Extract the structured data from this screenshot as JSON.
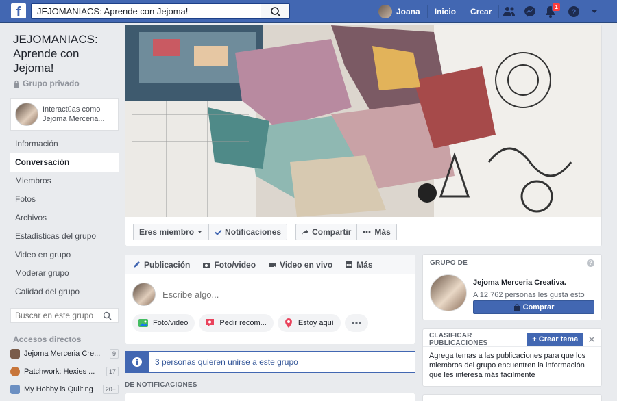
{
  "topbar": {
    "logo": "f",
    "search_value": "JEJOMANIACS: Aprende con Jejoma!",
    "user_name": "Joana",
    "home_label": "Inicio",
    "create_label": "Crear",
    "notification_count": "1"
  },
  "group": {
    "title": "JEJOMANIACS: Aprende con Jejoma!",
    "privacy": "Grupo privado",
    "interacting_as": "Interactúas como Jejoma Merceria..."
  },
  "nav": {
    "items": [
      {
        "label": "Información"
      },
      {
        "label": "Conversación"
      },
      {
        "label": "Miembros"
      },
      {
        "label": "Fotos"
      },
      {
        "label": "Archivos"
      },
      {
        "label": "Estadísticas del grupo"
      },
      {
        "label": "Video en grupo"
      },
      {
        "label": "Moderar grupo"
      },
      {
        "label": "Calidad del grupo"
      }
    ],
    "search_placeholder": "Buscar en este grupo"
  },
  "shortcuts": {
    "heading": "Accesos directos",
    "items": [
      {
        "label": "Jejoma Merceria Cre...",
        "count": "9",
        "color": "#7a5c4a"
      },
      {
        "label": "Patchwork: Hexies ...",
        "count": "17",
        "color": "#c7753a"
      },
      {
        "label": "My Hobby is Quilting",
        "count": "20+",
        "color": "#6b8fc2"
      }
    ]
  },
  "cover": {
    "member_button": "Eres miembro",
    "notifications_button": "Notificaciones",
    "share_button": "Compartir",
    "more_button": "Más"
  },
  "composer": {
    "tabs": [
      {
        "label": "Publicación"
      },
      {
        "label": "Foto/video"
      },
      {
        "label": "Video en vivo"
      },
      {
        "label": "Más"
      }
    ],
    "placeholder": "Escribe algo...",
    "options": [
      {
        "label": "Foto/video"
      },
      {
        "label": "Pedir recom..."
      },
      {
        "label": "Estoy aquí"
      }
    ]
  },
  "join_banner": {
    "text": "3 personas quieren unirse a este grupo"
  },
  "notifications_heading": "DE NOTIFICACIONES",
  "group_of": {
    "heading": "GRUPO DE",
    "page_name": "Jejoma Merceria Creativa.",
    "likes": "A 12.762 personas les gusta esto",
    "buy_button": "Comprar"
  },
  "classify": {
    "heading": "CLASIFICAR PUBLICACIONES",
    "create_button": "+ Crear tema",
    "body": "Agrega temas a las publicaciones para que los miembros del grupo encuentren la información que les interesa más fácilmente"
  },
  "colors": {
    "brand": "#4267b2",
    "background": "#e9ebee",
    "notification_badge": "#fa3e3e"
  }
}
